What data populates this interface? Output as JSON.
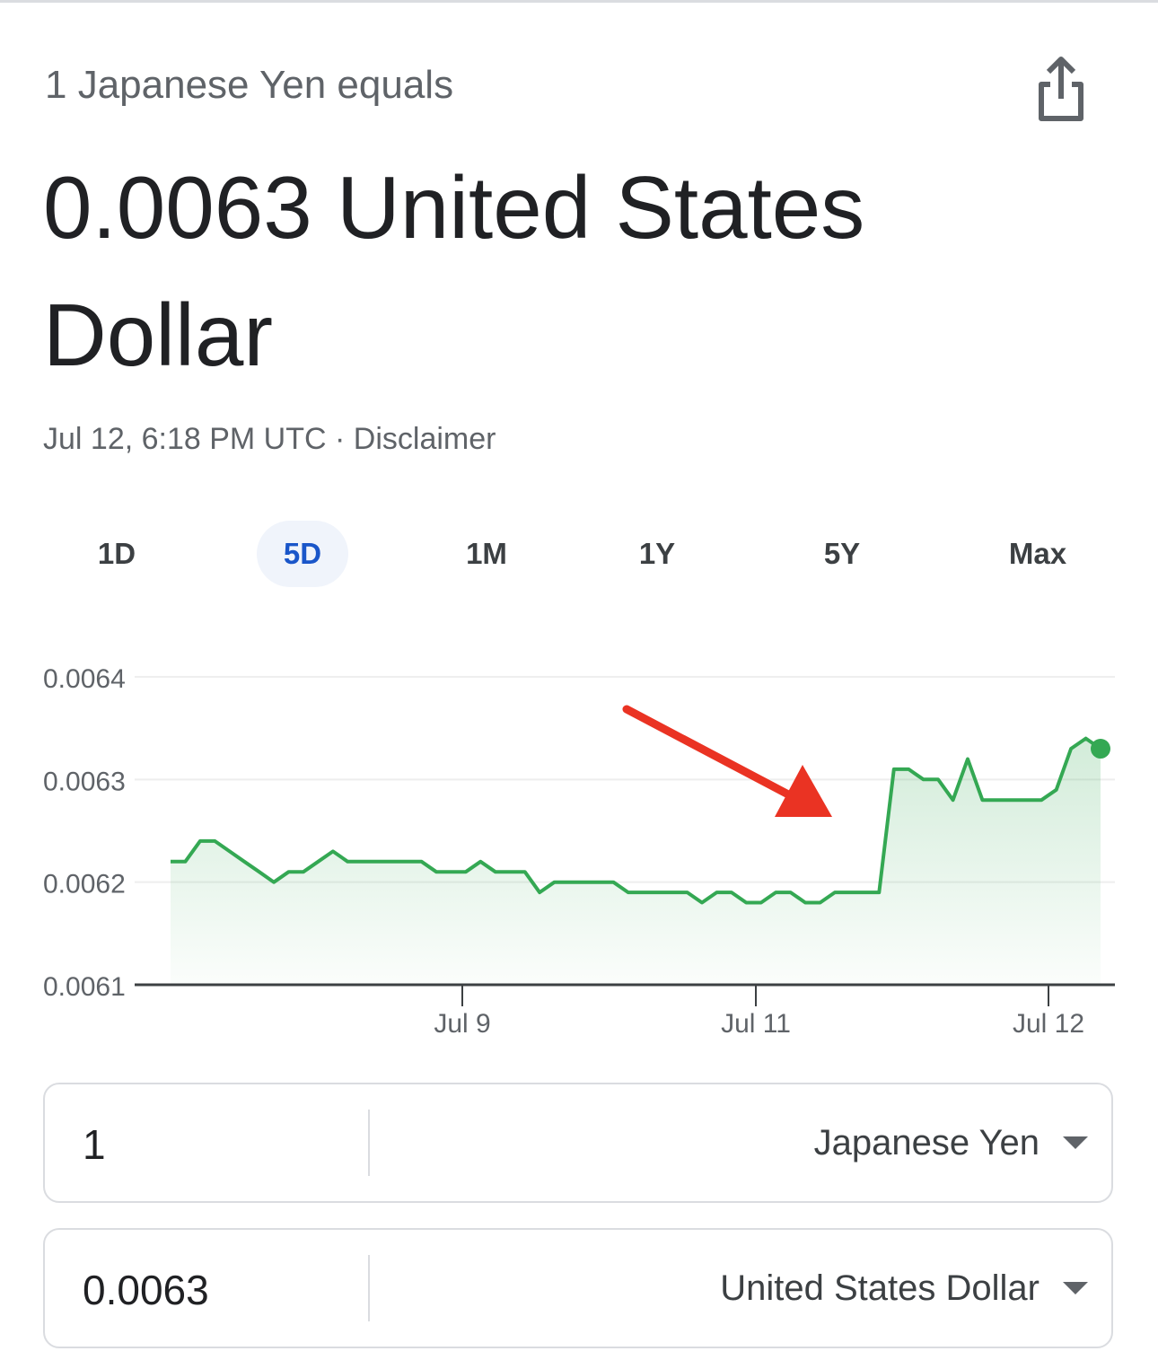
{
  "header": {
    "subtitle": "1 Japanese Yen equals",
    "result": "0.0063 United States Dollar",
    "timestamp": "Jul 12, 6:18 PM UTC",
    "separator": " · ",
    "disclaimer": "Disclaimer",
    "share_icon": "share-icon"
  },
  "tabs": [
    {
      "label": "1D",
      "active": false
    },
    {
      "label": "5D",
      "active": true
    },
    {
      "label": "1M",
      "active": false
    },
    {
      "label": "1Y",
      "active": false
    },
    {
      "label": "5Y",
      "active": false
    },
    {
      "label": "Max",
      "active": false
    }
  ],
  "colors": {
    "line": "#34a853",
    "annotation_arrow": "#ea3323",
    "active_tab": "#1a56c9"
  },
  "chart_data": {
    "type": "area",
    "x_ticks": [
      "Jul 9",
      "Jul 11",
      "Jul 12"
    ],
    "y_ticks": [
      "0.0064",
      "0.0063",
      "0.0062",
      "0.0061"
    ],
    "ylim": [
      0.0061,
      0.0064
    ],
    "grid": true,
    "annotation": "red arrow pointing to the jump on Jul 11",
    "series": [
      {
        "values": [
          0.00622,
          0.00622,
          0.00624,
          0.00624,
          0.00623,
          0.00622,
          0.00621,
          0.0062,
          0.00621,
          0.00621,
          0.00622,
          0.00623,
          0.00622,
          0.00622,
          0.00622,
          0.00622,
          0.00622,
          0.00622,
          0.00621,
          0.00621,
          0.00621,
          0.00622,
          0.00621,
          0.00621,
          0.00621,
          0.00619,
          0.0062,
          0.0062,
          0.0062,
          0.0062,
          0.0062,
          0.00619,
          0.00619,
          0.00619,
          0.00619,
          0.00619,
          0.00618,
          0.00619,
          0.00619,
          0.00618,
          0.00618,
          0.00619,
          0.00619,
          0.00618,
          0.00618,
          0.00619,
          0.00619,
          0.00619,
          0.00619,
          0.00631,
          0.00631,
          0.0063,
          0.0063,
          0.00628,
          0.00632,
          0.00628,
          0.00628,
          0.00628,
          0.00628,
          0.00628,
          0.00629,
          0.00633,
          0.00634,
          0.00633
        ]
      }
    ]
  },
  "converter": {
    "from": {
      "amount": "1",
      "currency": "Japanese Yen"
    },
    "to": {
      "amount": "0.0063",
      "currency": "United States Dollar"
    }
  }
}
